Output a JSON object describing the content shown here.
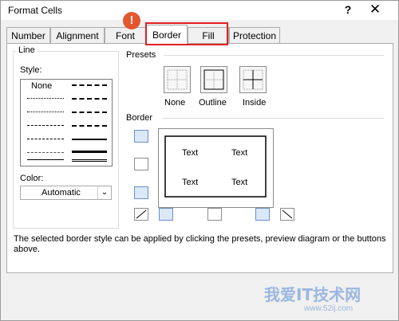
{
  "window": {
    "title": "Format Cells",
    "help_glyph": "?",
    "close_glyph": "✕"
  },
  "tabs": [
    {
      "label": "Number"
    },
    {
      "label": "Alignment"
    },
    {
      "label": "Font"
    },
    {
      "label": "Border",
      "active": true
    },
    {
      "label": "Fill"
    },
    {
      "label": "Protection"
    }
  ],
  "alert_glyph": "!",
  "line_group": {
    "heading": "Line",
    "style_label": "Style:",
    "style_first": "None",
    "color_label": "Color:",
    "color_value": "Automatic"
  },
  "presets": {
    "heading": "Presets",
    "items": [
      {
        "label": "None"
      },
      {
        "label": "Outline"
      },
      {
        "label": "Inside"
      }
    ]
  },
  "border": {
    "heading": "Border",
    "preview_text": [
      "Text",
      "Text",
      "Text",
      "Text"
    ]
  },
  "description": "The selected border style can be applied by clicking the presets, preview diagram or the buttons above.",
  "watermark": {
    "text": "我爱IT技术网",
    "url": "www.52ij.com"
  },
  "colors": {
    "accent": "#6b8fc9",
    "highlight": "#e02020",
    "alert": "#e4572e"
  }
}
